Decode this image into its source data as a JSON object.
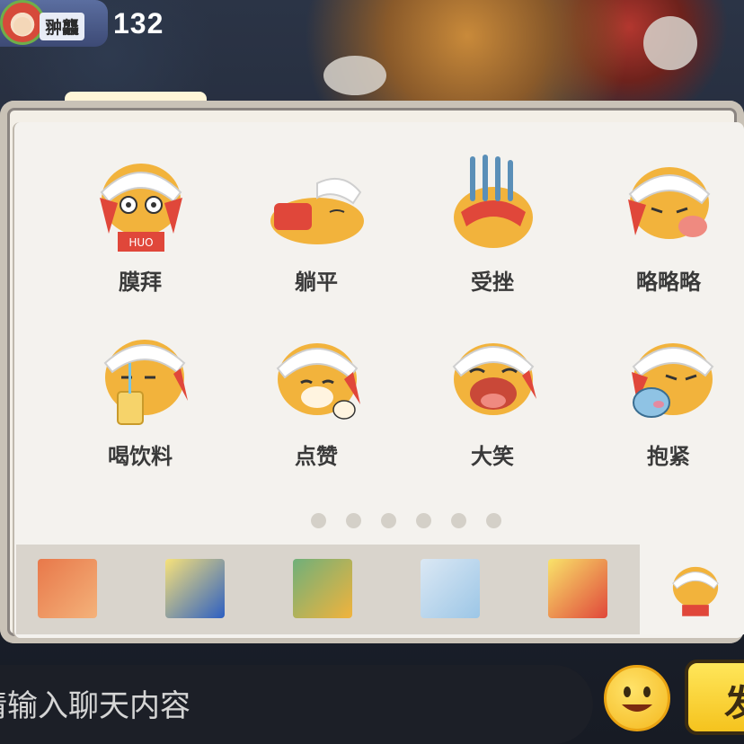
{
  "player": {
    "name": "翀龘",
    "score": "132"
  },
  "stickers": [
    {
      "label": "膜拜",
      "icon": "tiger-worship-icon"
    },
    {
      "label": "躺平",
      "icon": "tiger-lying-flat-icon"
    },
    {
      "label": "受挫",
      "icon": "tiger-frustrated-icon"
    },
    {
      "label": "略略略",
      "icon": "tiger-tongue-out-icon"
    },
    {
      "label": "喝饮料",
      "icon": "tiger-drinking-icon"
    },
    {
      "label": "点赞",
      "icon": "tiger-thumbs-up-icon"
    },
    {
      "label": "大笑",
      "icon": "tiger-laughing-icon"
    },
    {
      "label": "抱紧",
      "icon": "tiger-hug-icon"
    }
  ],
  "page_indicator": {
    "count": 6
  },
  "sticker_packs": [
    {
      "icon": "raccoon-flag-pack-icon"
    },
    {
      "icon": "sonic-pack-icon"
    },
    {
      "icon": "animal-group-pack-icon"
    },
    {
      "icon": "ice-girl-pack-icon"
    },
    {
      "icon": "bird-cake-pack-icon"
    },
    {
      "icon": "tiger-pack-icon",
      "active": true
    }
  ],
  "chat": {
    "placeholder": "请输入聊天内容",
    "send_label": "发"
  },
  "colors": {
    "panel": "#f3efe7",
    "accent_red": "#e0473a",
    "accent_yellow": "#f5c31e"
  }
}
